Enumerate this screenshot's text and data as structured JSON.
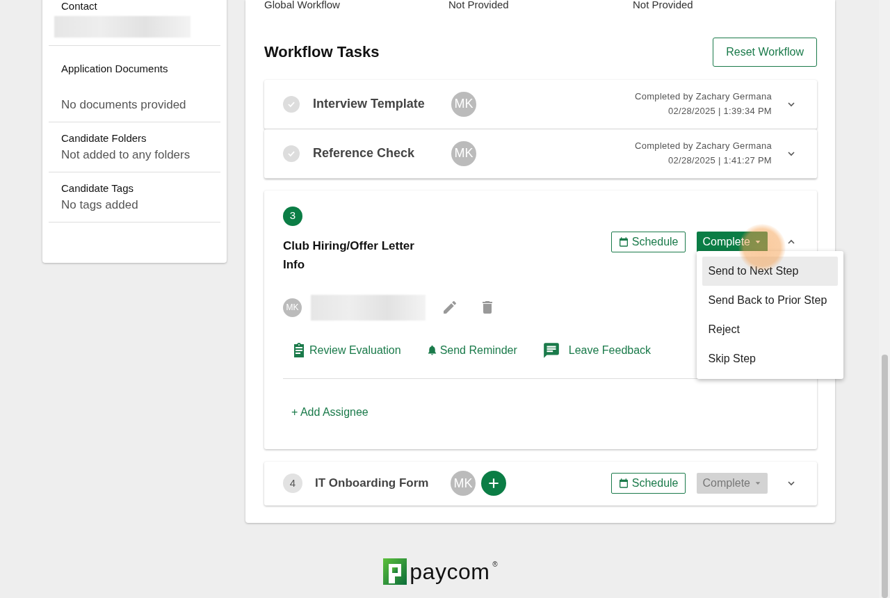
{
  "sidebar": {
    "sections": [
      {
        "title": "Contact",
        "redacted": true
      },
      {
        "title": "Application Documents",
        "value": "No documents provided",
        "spaced": true
      },
      {
        "title": "Candidate Folders",
        "value": "Not added to any folders"
      },
      {
        "title": "Candidate Tags",
        "value": "No tags added"
      }
    ]
  },
  "info_row": [
    "Global Workflow",
    "Not Provided",
    "Not Provided"
  ],
  "workflow": {
    "title": "Workflow Tasks",
    "reset_button": "Reset Workflow",
    "tasks": [
      {
        "kind": "completed",
        "title": "Interview Template",
        "avatar": "MK",
        "completed_by": "Completed by Zachary Germana",
        "completed_at": "02/28/2025 | 1:39:34 PM",
        "expanded": false
      },
      {
        "kind": "completed",
        "title": "Reference Check",
        "avatar": "MK",
        "completed_by": "Completed by Zachary Germana",
        "completed_at": "02/28/2025 | 1:41:27 PM",
        "expanded": false
      },
      {
        "kind": "active",
        "number": "3",
        "title": "Club Hiring/Offer Letter Info",
        "schedule": "Schedule",
        "complete": "Complete",
        "complete_disabled": false,
        "expanded": true,
        "assignee_avatar": "MK",
        "actions": [
          {
            "kind": "clipboard",
            "label": "Review Evaluation"
          },
          {
            "kind": "bell",
            "label": "Send Reminder"
          },
          {
            "kind": "chat",
            "label": "Leave Feedback"
          }
        ],
        "add_assignee": "+ Add Assignee",
        "menu": [
          {
            "label": "Send to Next Step",
            "selected": true
          },
          {
            "label": "Send Back to Prior Step",
            "selected": false
          },
          {
            "label": "Reject",
            "selected": false
          },
          {
            "label": "Skip Step",
            "selected": false
          }
        ]
      },
      {
        "kind": "pending",
        "number": "4",
        "title": "IT Onboarding Form",
        "avatar": "MK",
        "schedule": "Schedule",
        "complete": "Complete",
        "complete_disabled": true,
        "expanded": false
      }
    ]
  },
  "footer": {
    "logo": "paycom",
    "logo_mark": "®"
  }
}
